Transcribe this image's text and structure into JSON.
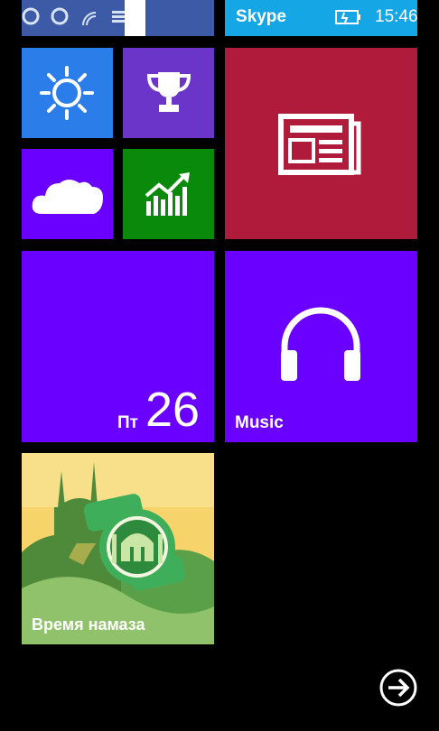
{
  "tiles": {
    "skype": {
      "label": "Skype",
      "time": "15:46"
    },
    "calendar": {
      "day_abbrev": "Пт",
      "day_number": "26"
    },
    "music": {
      "label": "Music"
    },
    "prayer": {
      "label": "Время намаза"
    }
  },
  "colors": {
    "background": "#000000",
    "skype_tile": "#15a6e6",
    "weather_tile": "#2b7de9",
    "trophy_tile": "#6a35c8",
    "news_tile": "#b01b3b",
    "cloud_tile": "#6a00ff",
    "money_tile": "#0a8a0a",
    "calendar_tile": "#6a00ff",
    "music_tile": "#6a00ff",
    "prayer_tile": "#f6d36b"
  },
  "icons": {
    "weather": "sun-icon",
    "trophy": "trophy-icon",
    "news": "newspaper-icon",
    "cloud": "onedrive-cloud-icon",
    "money": "chart-growth-icon",
    "music": "headphones-icon",
    "next": "arrow-circle-right-icon"
  }
}
